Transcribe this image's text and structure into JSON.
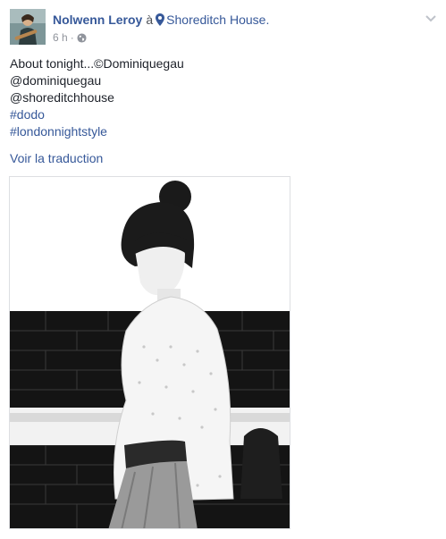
{
  "post": {
    "author": "Nolwenn Leroy",
    "at_word": "à",
    "place": "Shoreditch House",
    "place_suffix": ".",
    "time": "6 h",
    "separator": "·",
    "privacy_icon": "globe-icon",
    "menu_icon": "chevron-down-icon",
    "place_icon": "location-pin-icon",
    "text_lines": [
      "About tonight...©Dominiquegau",
      "@dominiquegau",
      "@shoreditchhouse"
    ],
    "hashtags": [
      "#dodo",
      "#londonnightstyle"
    ],
    "translate_label": "Voir la traduction"
  },
  "colors": {
    "link": "#365899",
    "text": "#1d2129",
    "meta": "#90949c",
    "border": "#dddfe2"
  }
}
